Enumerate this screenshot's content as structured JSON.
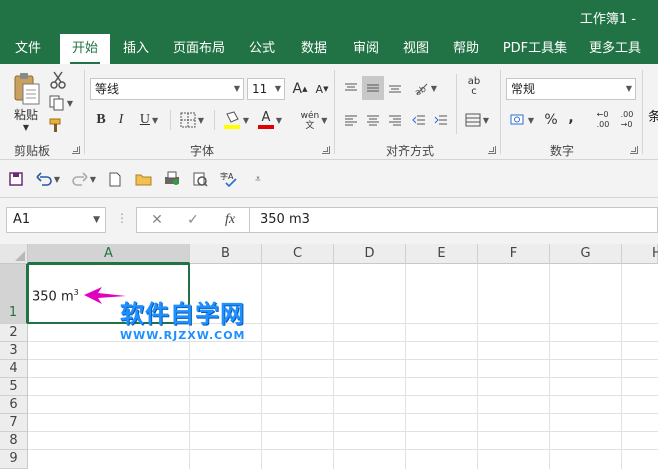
{
  "window": {
    "title": "工作簿1 -"
  },
  "tabs": [
    "文件",
    "开始",
    "插入",
    "页面布局",
    "公式",
    "数据",
    "审阅",
    "视图",
    "帮助",
    "PDF工具集",
    "更多工具"
  ],
  "active_tab": "开始",
  "ribbon": {
    "clipboard": {
      "paste_label": "粘贴",
      "group_label": "剪贴板"
    },
    "font": {
      "font_name": "等线",
      "font_size": "11",
      "bold": "B",
      "italic": "I",
      "underline": "U",
      "grow": "A",
      "shrink": "A",
      "font_color_letter": "A",
      "wen": "wén\n文",
      "group_label": "字体",
      "fill_color": "#ffff00",
      "font_color": "#e00000"
    },
    "alignment": {
      "group_label": "对齐方式",
      "wrap_label": "ab\nc"
    },
    "number": {
      "format": "常规",
      "percent": "%",
      "comma": ",",
      "inc_decimal": "←0\n.00",
      "dec_decimal": ".00\n→0",
      "group_label": "数字"
    },
    "partial_label": "条"
  },
  "formula_bar": {
    "name_box": "A1",
    "fx": "fx",
    "value": "350 m3",
    "dots": "⋮"
  },
  "columns": [
    "A",
    "B",
    "C",
    "D",
    "E",
    "F",
    "G",
    "H"
  ],
  "rows": [
    "1",
    "2",
    "3",
    "4",
    "5",
    "6",
    "7",
    "8",
    "9"
  ],
  "cell_A1": {
    "main": "350 m",
    "superscript": "3"
  },
  "watermark": {
    "title": "软件自学网",
    "url": "WWW.RJZXW.COM"
  },
  "colors": {
    "accent": "#217346",
    "arrow": "#e000c0",
    "watermark": "#1e90ff"
  }
}
